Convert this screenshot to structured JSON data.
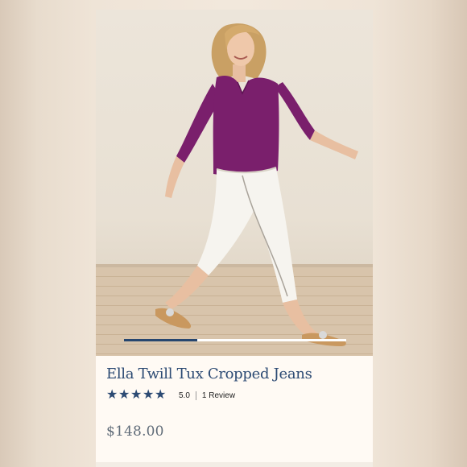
{
  "product": {
    "title": "Ella Twill Tux Cropped Jeans",
    "rating": {
      "stars": 5,
      "value": "5.0",
      "review_count": "1 Review",
      "star_glyph": "★"
    },
    "price": "$148.00"
  },
  "carousel": {
    "progress": 0.33
  },
  "colors": {
    "accent": "#2c4a73",
    "price": "#5f6b78",
    "top": "#7a1f6c",
    "jeans": "#f6f4ef"
  },
  "image": {
    "alt": "Model walking in purple top and white cropped jeans"
  }
}
